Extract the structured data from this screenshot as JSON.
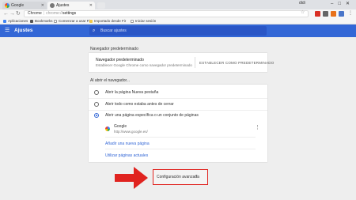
{
  "browser": {
    "tabs": [
      {
        "label": "Google"
      },
      {
        "label": "Ajustes"
      }
    ],
    "user": "didi",
    "window_controls": "–□✕",
    "omnibox": {
      "secure_label": "Chrome",
      "scheme": "chrome://",
      "path": "settings"
    },
    "bookmarks": [
      {
        "label": "Aplicaciones"
      },
      {
        "label": "Bookmarks"
      },
      {
        "label": "Comenzar a usar Fir"
      },
      {
        "label": "Importado desde Fir"
      },
      {
        "label": "Iniciar sesión"
      }
    ]
  },
  "settings": {
    "title": "Ajustes",
    "search_placeholder": "Buscar ajustes",
    "default_browser": {
      "section_title": "Navegador predeterminado",
      "row_title": "Navegador predeterminado",
      "row_subtitle": "Establecer Google Chrome como navegador predeterminado",
      "button_label": "ESTABLECER COMO PREDETERMINADO"
    },
    "on_startup": {
      "section_title": "Al abrir el navegador...",
      "options": [
        {
          "label": "Abrir la página Nueva pestaña",
          "selected": false
        },
        {
          "label": "Abrir todo como estaba antes de cerrar",
          "selected": false
        },
        {
          "label": "Abrir una página específica o un conjunto de páginas",
          "selected": true
        }
      ],
      "pages": [
        {
          "name": "Google",
          "url": "http://www.google.es/"
        }
      ],
      "add_page": "Añadir una nueva página",
      "use_current": "Utilizar páginas actuales"
    },
    "advanced": {
      "label": "Configuración avanzada",
      "chevron": "▾"
    }
  },
  "colors": {
    "header": "#3367d6",
    "highlight": "#e0231f",
    "link": "#3367d6"
  }
}
